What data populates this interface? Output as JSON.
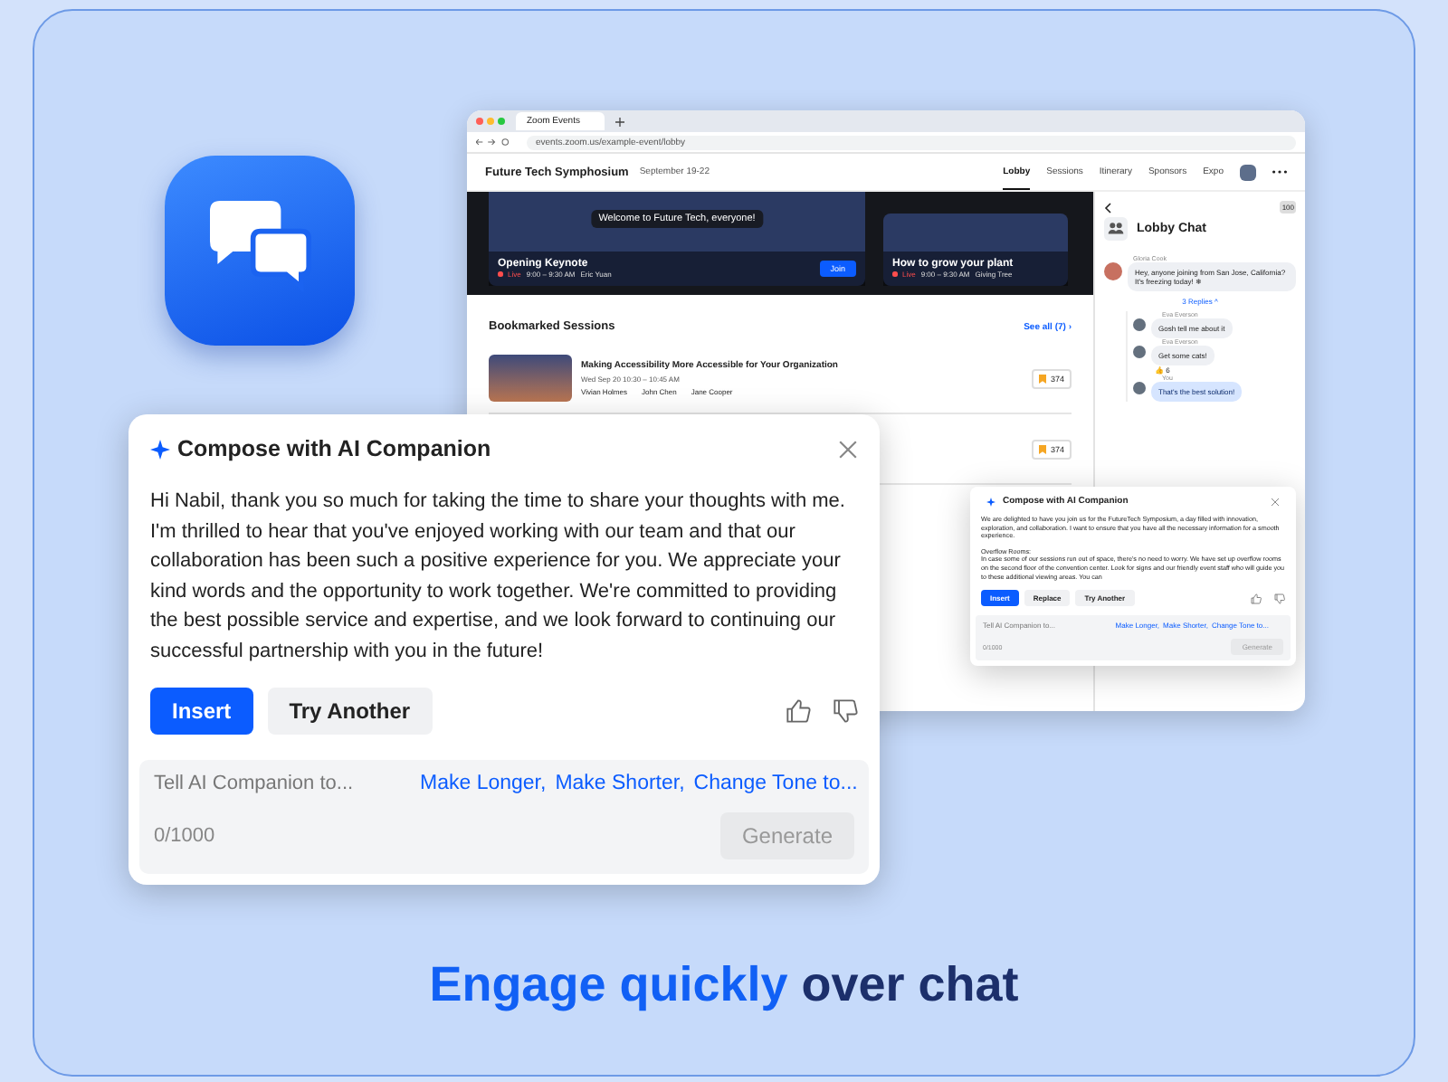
{
  "browser": {
    "tab_title": "Zoom Events",
    "url": "events.zoom.us/example-event/lobby",
    "event_title": "Future Tech Symphosium",
    "event_dates": "September 19-22",
    "nav": [
      {
        "label": "Lobby",
        "selected": true
      },
      {
        "label": "Sessions",
        "selected": false
      },
      {
        "label": "Itinerary",
        "selected": false
      },
      {
        "label": "Sponsors",
        "selected": false
      },
      {
        "label": "Expo",
        "selected": false
      }
    ],
    "hero": {
      "caption": "Welcome to Future Tech, everyone!",
      "cards": [
        {
          "title": "Opening Keynote",
          "live": "Live",
          "time": "9:00 – 9:30 AM",
          "host": "Eric Yuan",
          "button": "Join"
        },
        {
          "title": "How to grow your plant",
          "live": "Live",
          "time": "9:00 – 9:30 AM",
          "host": "Giving Tree"
        }
      ]
    },
    "bookmarked": {
      "title": "Bookmarked Sessions",
      "see_all": "See all (7) ›",
      "sessions": [
        {
          "title": "Making Accessibility More Accessible for Your Organization",
          "time": "Wed Sep 20 10:30 – 10:45 AM",
          "speakers": [
            "Vivian Holmes",
            "John Chen",
            "Jane Cooper"
          ],
          "bookmark_count": "374"
        },
        {
          "bookmark_count": "374"
        }
      ]
    },
    "chat": {
      "title": "Lobby Chat",
      "member_count": "100",
      "messages": [
        {
          "name": "Gloria Cook",
          "text": "Hey, anyone joining from San Jose, California? It's freezing today! ❄",
          "replies_label": "3 Replies ^",
          "children": [
            {
              "name": "Eva Everson",
              "text": "Gosh tell me about it",
              "mine": false
            },
            {
              "name": "Eva Everson",
              "text": "Get some cats!",
              "reaction": "👍 6",
              "mine": false
            },
            {
              "name": "You",
              "text": "That's the best solution!",
              "mine": true
            }
          ]
        }
      ]
    },
    "mini_compose": {
      "title": "Compose with AI Companion",
      "paragraphs": [
        "We are delighted to have you join us for the FutureTech Symposium, a day filled with innovation, exploration, and collaboration. I want to ensure that you have all the necessary information for a smooth experience.",
        "Overflow Rooms:\nIn case some of our sessions run out of space, there's no need to worry. We have set up overflow rooms on the second floor of the convention center. Look for signs and our friendly event staff who will guide you to these additional viewing areas. You can"
      ],
      "buttons": [
        {
          "label": "Insert",
          "primary": true
        },
        {
          "label": "Replace",
          "primary": false
        },
        {
          "label": "Try Another",
          "primary": false
        }
      ],
      "placeholder": "Tell AI Companion to...",
      "suggestions": [
        "Make Longer,",
        "Make Shorter,",
        "Change Tone to..."
      ],
      "counter": "0/1000",
      "generate": {
        "label": "Generate",
        "disabled": true
      }
    }
  },
  "compose": {
    "title": "Compose with AI Companion",
    "paragraphs": [
      "Hi Nabil, thank you so much for taking the time to share your thoughts with me. I'm thrilled to hear that you've enjoyed working with our team and that our collaboration has been such a positive experience for you. We appreciate your kind words and the opportunity to work together. We're committed to providing the best possible service and expertise, and we look forward to continuing our successful partnership with you in the future!"
    ],
    "buttons": [
      {
        "label": "Insert",
        "primary": true
      },
      {
        "label": "Try Another",
        "primary": false
      }
    ],
    "placeholder": "Tell AI Companion to...",
    "suggestions": [
      "Make Longer,",
      "Make Shorter,",
      "Change Tone to..."
    ],
    "counter": "0/1000",
    "generate": {
      "label": "Generate",
      "disabled": true
    }
  },
  "tagline": {
    "highlight": "Engage quickly",
    "rest": "over chat"
  }
}
